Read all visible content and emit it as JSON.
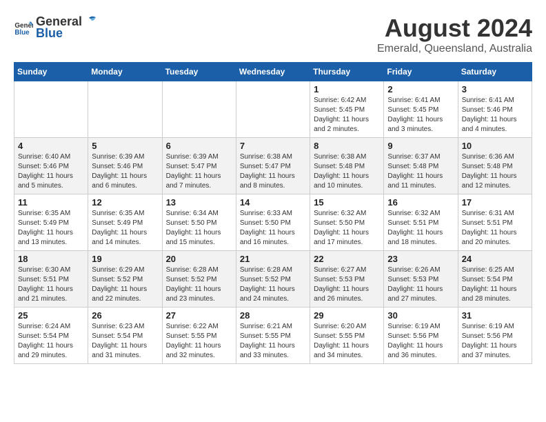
{
  "header": {
    "logo_general": "General",
    "logo_blue": "Blue",
    "title": "August 2024",
    "subtitle": "Emerald, Queensland, Australia"
  },
  "days_of_week": [
    "Sunday",
    "Monday",
    "Tuesday",
    "Wednesday",
    "Thursday",
    "Friday",
    "Saturday"
  ],
  "weeks": [
    [
      {
        "day": "",
        "info": ""
      },
      {
        "day": "",
        "info": ""
      },
      {
        "day": "",
        "info": ""
      },
      {
        "day": "",
        "info": ""
      },
      {
        "day": "1",
        "info": "Sunrise: 6:42 AM\nSunset: 5:45 PM\nDaylight: 11 hours and 2 minutes."
      },
      {
        "day": "2",
        "info": "Sunrise: 6:41 AM\nSunset: 5:45 PM\nDaylight: 11 hours and 3 minutes."
      },
      {
        "day": "3",
        "info": "Sunrise: 6:41 AM\nSunset: 5:46 PM\nDaylight: 11 hours and 4 minutes."
      }
    ],
    [
      {
        "day": "4",
        "info": "Sunrise: 6:40 AM\nSunset: 5:46 PM\nDaylight: 11 hours and 5 minutes."
      },
      {
        "day": "5",
        "info": "Sunrise: 6:39 AM\nSunset: 5:46 PM\nDaylight: 11 hours and 6 minutes."
      },
      {
        "day": "6",
        "info": "Sunrise: 6:39 AM\nSunset: 5:47 PM\nDaylight: 11 hours and 7 minutes."
      },
      {
        "day": "7",
        "info": "Sunrise: 6:38 AM\nSunset: 5:47 PM\nDaylight: 11 hours and 8 minutes."
      },
      {
        "day": "8",
        "info": "Sunrise: 6:38 AM\nSunset: 5:48 PM\nDaylight: 11 hours and 10 minutes."
      },
      {
        "day": "9",
        "info": "Sunrise: 6:37 AM\nSunset: 5:48 PM\nDaylight: 11 hours and 11 minutes."
      },
      {
        "day": "10",
        "info": "Sunrise: 6:36 AM\nSunset: 5:48 PM\nDaylight: 11 hours and 12 minutes."
      }
    ],
    [
      {
        "day": "11",
        "info": "Sunrise: 6:35 AM\nSunset: 5:49 PM\nDaylight: 11 hours and 13 minutes."
      },
      {
        "day": "12",
        "info": "Sunrise: 6:35 AM\nSunset: 5:49 PM\nDaylight: 11 hours and 14 minutes."
      },
      {
        "day": "13",
        "info": "Sunrise: 6:34 AM\nSunset: 5:50 PM\nDaylight: 11 hours and 15 minutes."
      },
      {
        "day": "14",
        "info": "Sunrise: 6:33 AM\nSunset: 5:50 PM\nDaylight: 11 hours and 16 minutes."
      },
      {
        "day": "15",
        "info": "Sunrise: 6:32 AM\nSunset: 5:50 PM\nDaylight: 11 hours and 17 minutes."
      },
      {
        "day": "16",
        "info": "Sunrise: 6:32 AM\nSunset: 5:51 PM\nDaylight: 11 hours and 18 minutes."
      },
      {
        "day": "17",
        "info": "Sunrise: 6:31 AM\nSunset: 5:51 PM\nDaylight: 11 hours and 20 minutes."
      }
    ],
    [
      {
        "day": "18",
        "info": "Sunrise: 6:30 AM\nSunset: 5:51 PM\nDaylight: 11 hours and 21 minutes."
      },
      {
        "day": "19",
        "info": "Sunrise: 6:29 AM\nSunset: 5:52 PM\nDaylight: 11 hours and 22 minutes."
      },
      {
        "day": "20",
        "info": "Sunrise: 6:28 AM\nSunset: 5:52 PM\nDaylight: 11 hours and 23 minutes."
      },
      {
        "day": "21",
        "info": "Sunrise: 6:28 AM\nSunset: 5:52 PM\nDaylight: 11 hours and 24 minutes."
      },
      {
        "day": "22",
        "info": "Sunrise: 6:27 AM\nSunset: 5:53 PM\nDaylight: 11 hours and 26 minutes."
      },
      {
        "day": "23",
        "info": "Sunrise: 6:26 AM\nSunset: 5:53 PM\nDaylight: 11 hours and 27 minutes."
      },
      {
        "day": "24",
        "info": "Sunrise: 6:25 AM\nSunset: 5:54 PM\nDaylight: 11 hours and 28 minutes."
      }
    ],
    [
      {
        "day": "25",
        "info": "Sunrise: 6:24 AM\nSunset: 5:54 PM\nDaylight: 11 hours and 29 minutes."
      },
      {
        "day": "26",
        "info": "Sunrise: 6:23 AM\nSunset: 5:54 PM\nDaylight: 11 hours and 31 minutes."
      },
      {
        "day": "27",
        "info": "Sunrise: 6:22 AM\nSunset: 5:55 PM\nDaylight: 11 hours and 32 minutes."
      },
      {
        "day": "28",
        "info": "Sunrise: 6:21 AM\nSunset: 5:55 PM\nDaylight: 11 hours and 33 minutes."
      },
      {
        "day": "29",
        "info": "Sunrise: 6:20 AM\nSunset: 5:55 PM\nDaylight: 11 hours and 34 minutes."
      },
      {
        "day": "30",
        "info": "Sunrise: 6:19 AM\nSunset: 5:56 PM\nDaylight: 11 hours and 36 minutes."
      },
      {
        "day": "31",
        "info": "Sunrise: 6:19 AM\nSunset: 5:56 PM\nDaylight: 11 hours and 37 minutes."
      }
    ]
  ]
}
